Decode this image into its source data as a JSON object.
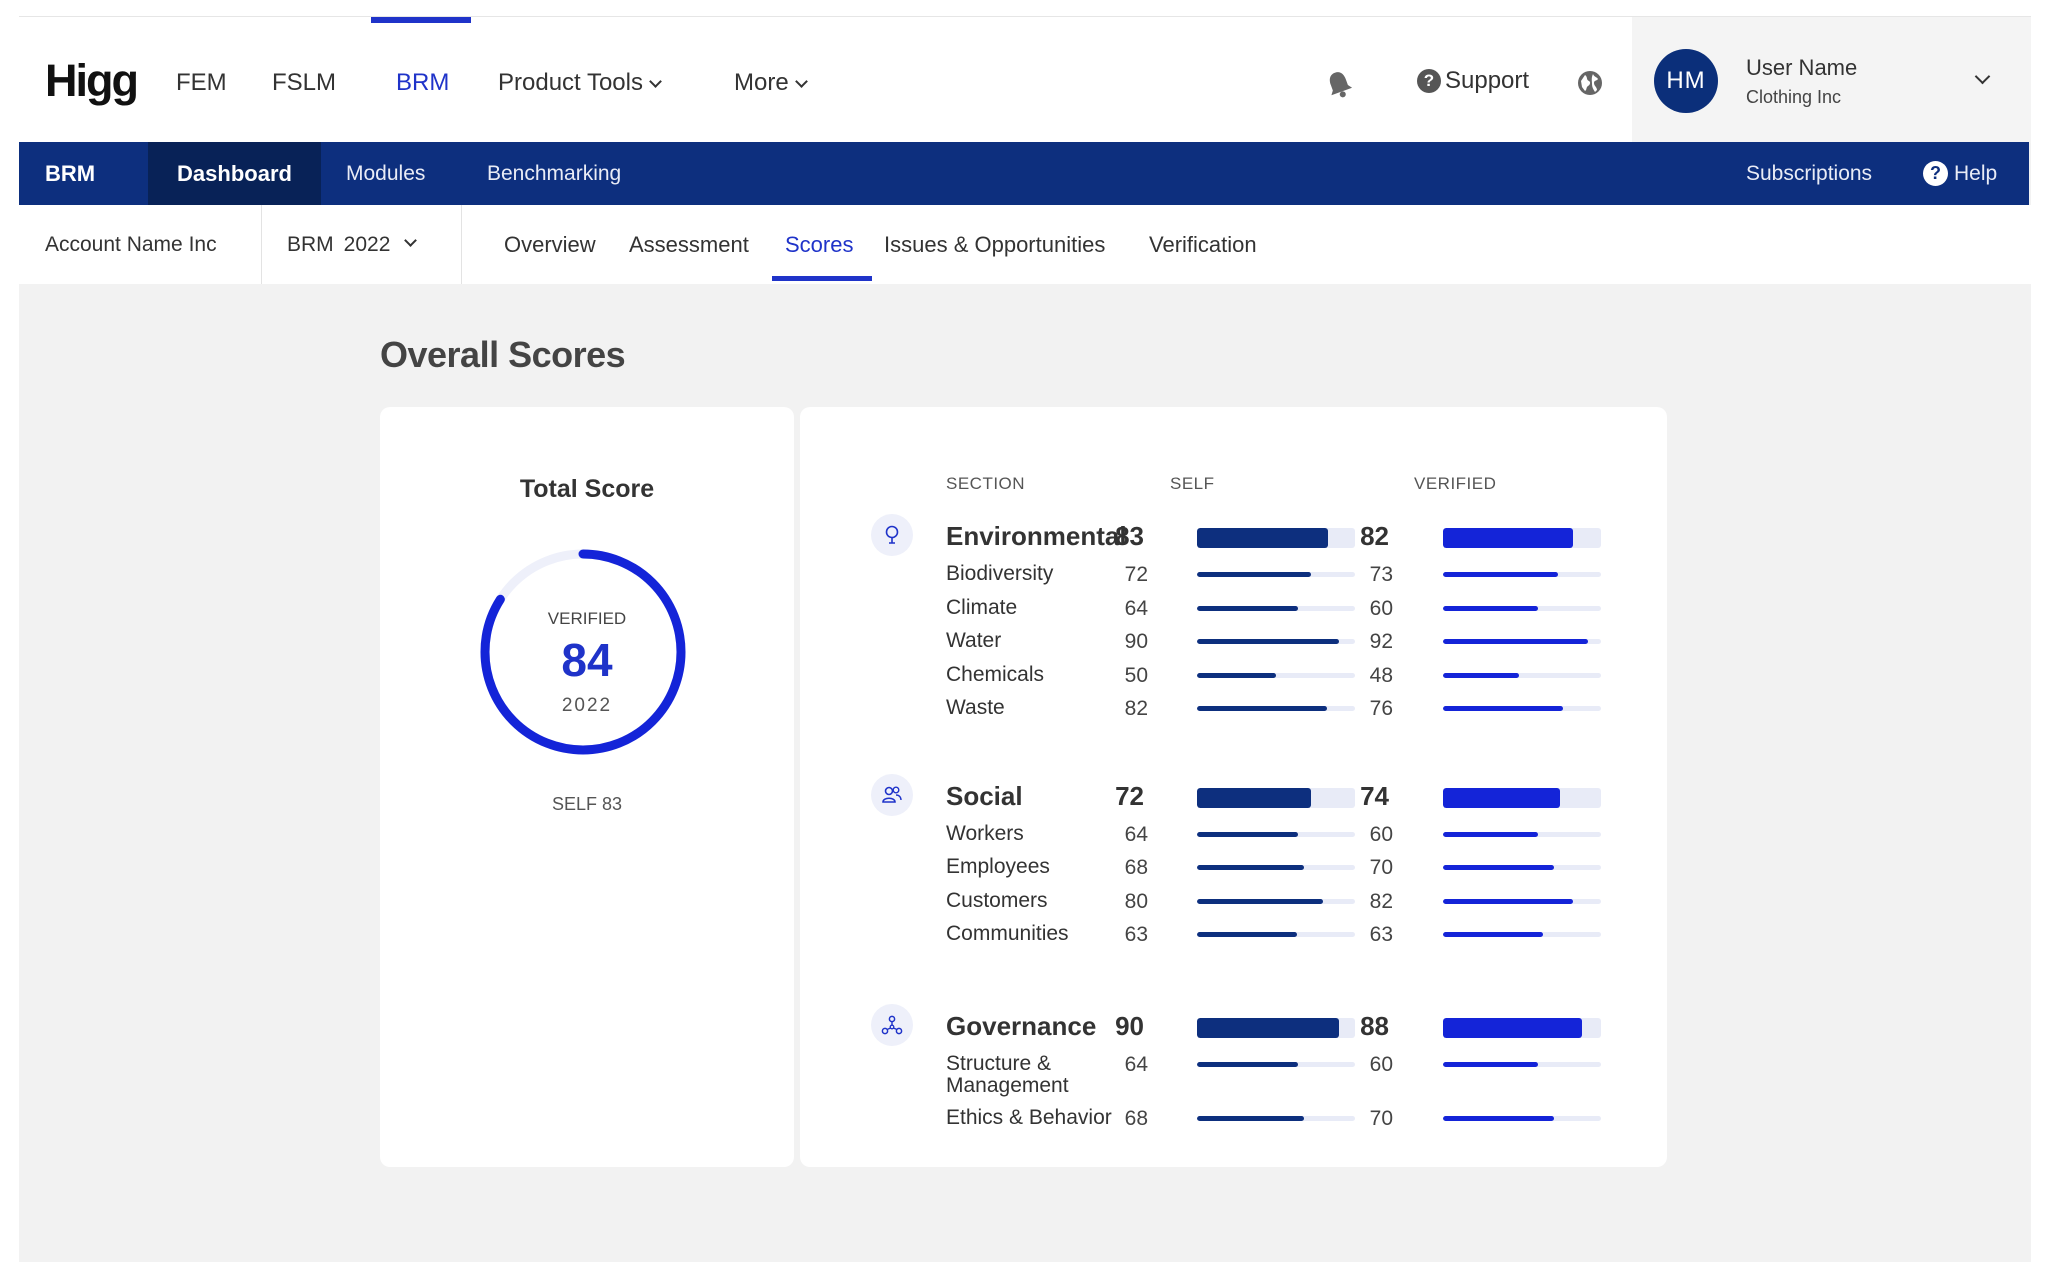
{
  "topnav": {
    "logo": "Higg",
    "links": [
      {
        "label": "FEM",
        "active": false
      },
      {
        "label": "FSLM",
        "active": false
      },
      {
        "label": "BRM",
        "active": true
      },
      {
        "label": "Product Tools",
        "active": false
      },
      {
        "label": "More",
        "active": false
      }
    ],
    "support_label": "Support",
    "support_glyph": "?",
    "user": {
      "initials": "HM",
      "name": "User Name",
      "company": "Clothing Inc"
    }
  },
  "bluebar": {
    "module": "BRM",
    "items": [
      "Dashboard",
      "Modules",
      "Benchmarking"
    ],
    "subscriptions": "Subscriptions",
    "help": "Help",
    "help_glyph": "?"
  },
  "subnav": {
    "account": "Account Name Inc",
    "selector": {
      "module": "BRM",
      "year": "2022"
    },
    "tabs": [
      {
        "label": "Overview",
        "active": false
      },
      {
        "label": "Assessment",
        "active": false
      },
      {
        "label": "Scores",
        "active": true
      },
      {
        "label": "Issues & Opportunities",
        "active": false
      },
      {
        "label": "Verification",
        "active": false
      }
    ]
  },
  "page": {
    "title": "Overall Scores"
  },
  "total_score": {
    "title": "Total Score",
    "verified_label": "VERIFIED",
    "verified_score": "84",
    "verified_fraction": 0.84,
    "year": "2022",
    "self_label": "SELF 83"
  },
  "scores": {
    "headers": {
      "section": "SECTION",
      "self": "SELF",
      "verified": "VERIFIED"
    },
    "sections": [
      {
        "name": "Environmental",
        "icon": "tree-icon",
        "self": 83,
        "verified": 82,
        "subs": [
          {
            "name": "Biodiversity",
            "self": 72,
            "verified": 73
          },
          {
            "name": "Climate",
            "self": 64,
            "verified": 60
          },
          {
            "name": "Water",
            "self": 90,
            "verified": 92
          },
          {
            "name": "Chemicals",
            "self": 50,
            "verified": 48
          },
          {
            "name": "Waste",
            "self": 82,
            "verified": 76
          }
        ]
      },
      {
        "name": "Social",
        "icon": "people-icon",
        "self": 72,
        "verified": 74,
        "subs": [
          {
            "name": "Workers",
            "self": 64,
            "verified": 60
          },
          {
            "name": "Employees",
            "self": 68,
            "verified": 70
          },
          {
            "name": "Customers",
            "self": 80,
            "verified": 82
          },
          {
            "name": "Communities",
            "self": 63,
            "verified": 63
          }
        ]
      },
      {
        "name": "Governance",
        "icon": "network-icon",
        "self": 90,
        "verified": 88,
        "subs": [
          {
            "name": "Structure & Management",
            "self": 64,
            "verified": 60
          },
          {
            "name": "Ethics & Behavior",
            "self": 68,
            "verified": 70
          }
        ]
      }
    ]
  },
  "colors": {
    "self_bar": "#0d2f7e",
    "verified_bar": "#1424d8",
    "accent": "#1f33c9",
    "ring": "#1424d8"
  }
}
